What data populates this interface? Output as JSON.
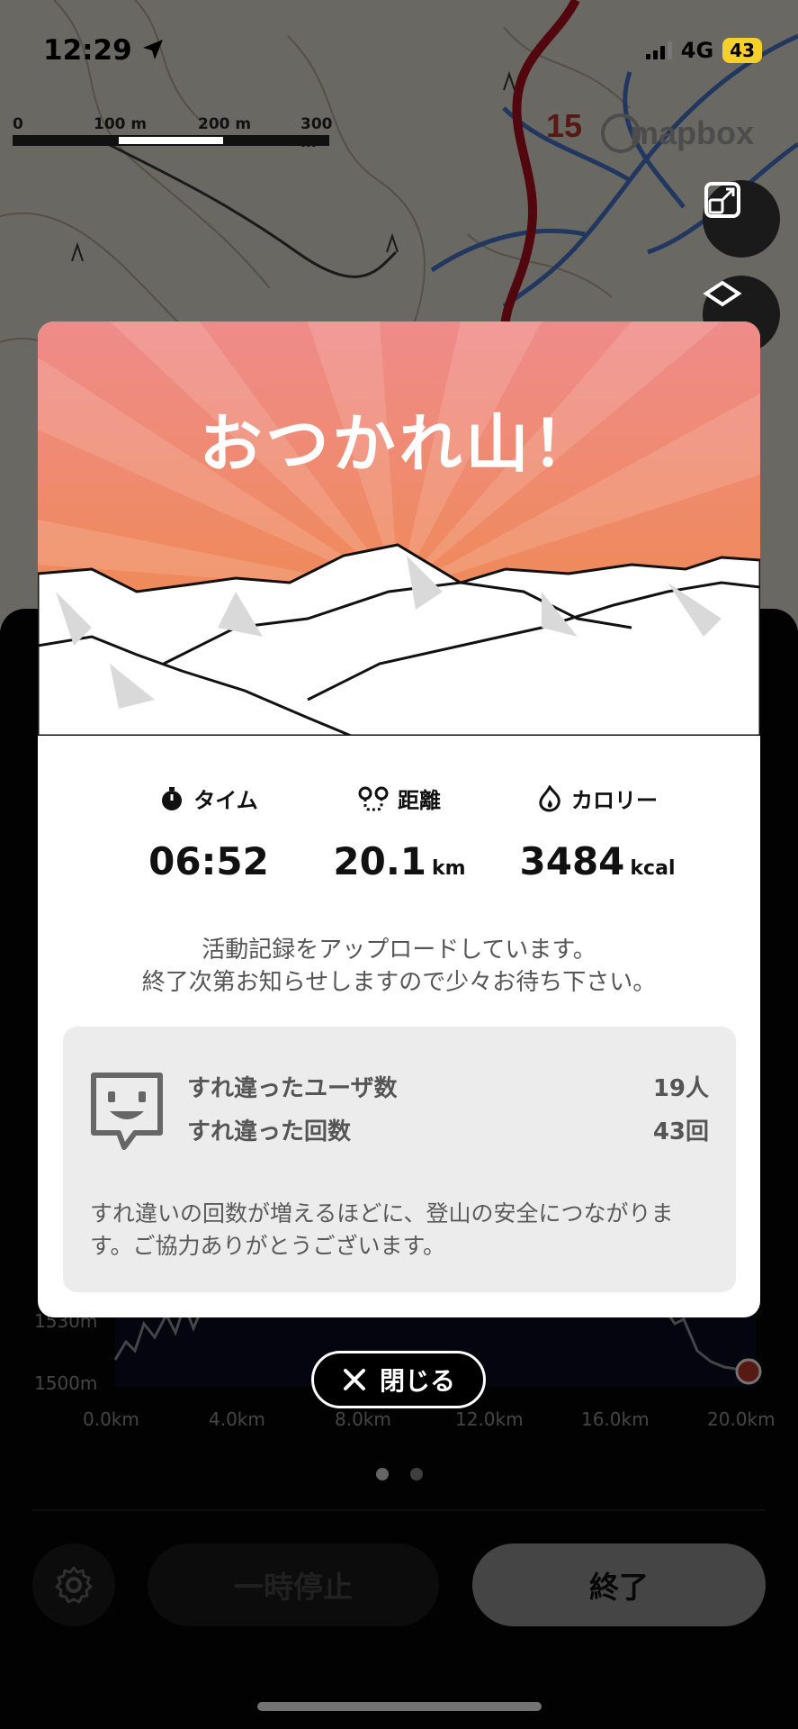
{
  "status_bar": {
    "time": "12:29",
    "network": "4G",
    "battery": "43"
  },
  "map": {
    "scale_labels": [
      "0",
      "100 m",
      "200 m",
      "300 m"
    ],
    "route_marker": "15",
    "attribution": "mapbox"
  },
  "modal": {
    "title": "おつかれ山！",
    "stats": {
      "time": {
        "label": "タイム",
        "value": "06:52"
      },
      "distance": {
        "label": "距離",
        "value": "20.1",
        "unit": "km"
      },
      "calories": {
        "label": "カロリー",
        "value": "3484",
        "unit": "kcal"
      }
    },
    "upload_message": [
      "活動記録をアップロードしています。",
      "終了次第お知らせしますので少々お待ち下さい。"
    ],
    "passing": {
      "users_label": "すれ違ったユーザ数",
      "users_value": "19人",
      "count_label": "すれ違った回数",
      "count_value": "43回",
      "note": "すれ違いの回数が増えるほどに、登山の安全につながります。ご協力ありがとうございます。"
    }
  },
  "close_button": {
    "label": "閉じる"
  },
  "elevation": {
    "y_labels": [
      "1530m",
      "1500m"
    ],
    "x_labels": [
      "0.0km",
      "4.0km",
      "8.0km",
      "12.0km",
      "16.0km",
      "20.0km"
    ]
  },
  "controls": {
    "pause_label": "一時停止",
    "end_label": "終了"
  },
  "colors": {
    "header_top": "#f08a88",
    "header_bottom": "#ef8a44",
    "accent_red": "#c0392b"
  },
  "icons": [
    "location-arrow-icon",
    "signal-icon",
    "expand-icon",
    "layers-icon",
    "stopwatch-icon",
    "route-icon",
    "flame-icon",
    "passing-face-icon",
    "close-icon",
    "gear-icon"
  ]
}
